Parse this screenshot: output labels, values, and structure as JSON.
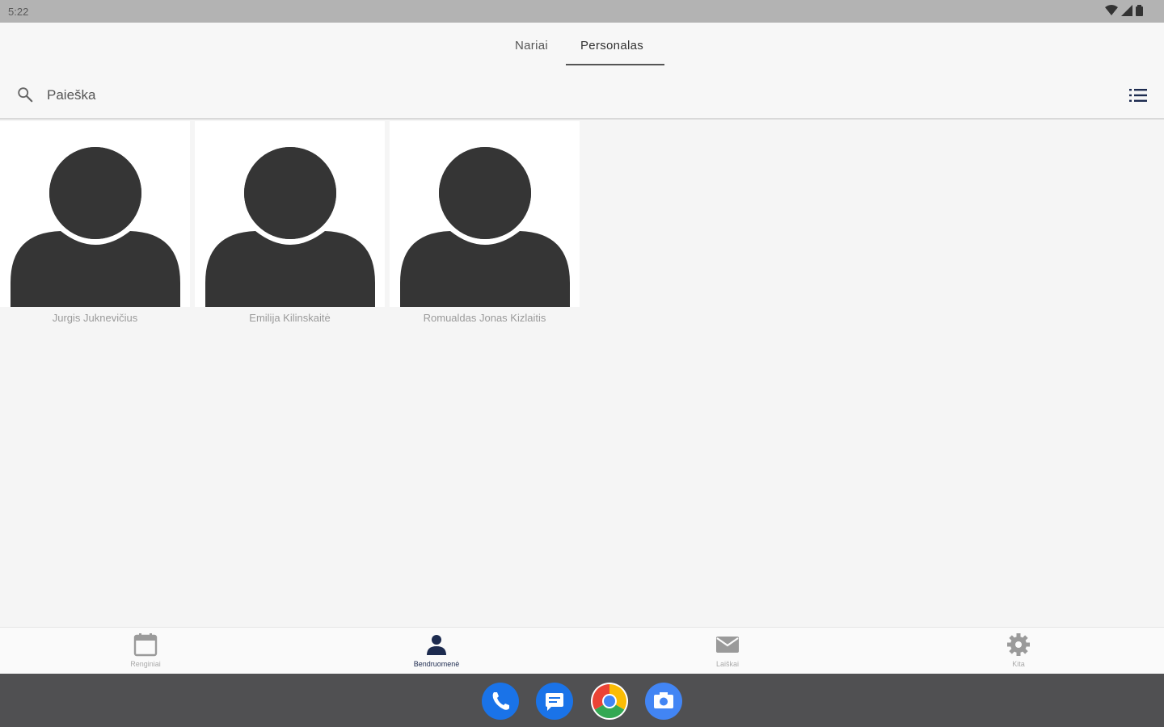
{
  "status_bar": {
    "time": "5:22"
  },
  "tabs": [
    {
      "label": "Nariai",
      "active": false
    },
    {
      "label": "Personalas",
      "active": true
    }
  ],
  "search": {
    "placeholder": "Paieška",
    "value": ""
  },
  "staff": [
    {
      "name": "Jurgis Juknevičius"
    },
    {
      "name": "Emilija Kilinskaitė"
    },
    {
      "name": "Romualdas Jonas Kizlaitis"
    }
  ],
  "bottom_nav": [
    {
      "label": "Renginiai",
      "icon": "calendar-icon",
      "active": false
    },
    {
      "label": "Bendruomenė",
      "icon": "person-icon",
      "active": true
    },
    {
      "label": "Laiškai",
      "icon": "mail-icon",
      "active": false
    },
    {
      "label": "Kita",
      "icon": "gear-icon",
      "active": false
    }
  ],
  "dock": [
    "phone-icon",
    "messages-icon",
    "chrome-icon",
    "camera-icon"
  ],
  "colors": {
    "accent": "#1d2b4f",
    "avatar": "#353535",
    "dock_blue": "#1a73e8"
  }
}
